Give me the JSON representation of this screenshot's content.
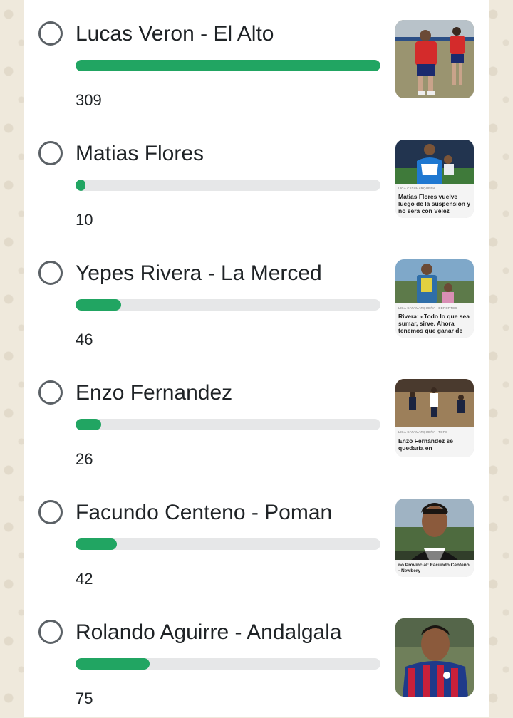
{
  "poll": {
    "options": [
      {
        "label": "Lucas Veron - El Alto",
        "votes": "309",
        "share": 1.0,
        "thumb": {
          "caption": "",
          "tag": ""
        }
      },
      {
        "label": "Matias Flores",
        "votes": "10",
        "share": 0.032,
        "thumb": {
          "caption": "Matias Flores vuelve luego de la suspensión y no será con Vélez",
          "tag": "LIGA CATAMARQUEÑA"
        }
      },
      {
        "label": "Yepes Rivera - La Merced",
        "votes": "46",
        "share": 0.149,
        "thumb": {
          "caption": "Rivera: «Todo lo que sea sumar, sirve. Ahora tenemos que ganar de",
          "tag": "LIGA CATAMARQUEÑA · DEPORTES"
        }
      },
      {
        "label": "Enzo Fernandez",
        "votes": "26",
        "share": 0.084,
        "thumb": {
          "caption": "Enzo Fernández se quedaría en",
          "tag": "LIGA CATAMARQUEÑA · TOPS"
        }
      },
      {
        "label": "Facundo Centeno - Poman",
        "votes": "42",
        "share": 0.136,
        "thumb": {
          "caption": "no Provincial: Facundo Centeno - Newbery",
          "tag": ""
        }
      },
      {
        "label": "Rolando Aguirre - Andalgala",
        "votes": "75",
        "share": 0.243,
        "thumb": {
          "caption": "",
          "tag": ""
        }
      }
    ]
  },
  "colors": {
    "bar_fill": "#21a562",
    "bar_track": "#e6e7e8",
    "radio_border": "#5b6166",
    "wallpaper": "#efe9dc"
  }
}
